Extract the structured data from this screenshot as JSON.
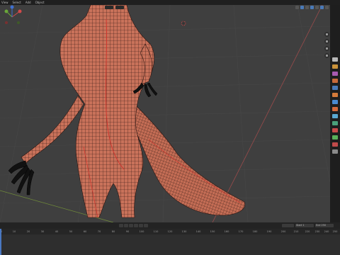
{
  "menu": {
    "items": [
      "View",
      "Select",
      "Add",
      "Object"
    ]
  },
  "timeline": {
    "ticks": [
      "0",
      "10",
      "20",
      "30",
      "40",
      "50",
      "60",
      "70",
      "80",
      "90",
      "100",
      "110",
      "120",
      "130",
      "140",
      "150",
      "160",
      "170",
      "180",
      "190",
      "200",
      "210",
      "220",
      "230",
      "240",
      "250"
    ],
    "start_label": "Start",
    "start_value": "1",
    "end_label": "End",
    "end_value": "250"
  },
  "colors": {
    "viewport_bg": "#3f3f3f",
    "mesh_fill": "#c9725a",
    "mesh_wire": "#2a1410",
    "claws": "#111111",
    "seam": "#d2312a",
    "timeline_cursor": "#4a78c2"
  }
}
